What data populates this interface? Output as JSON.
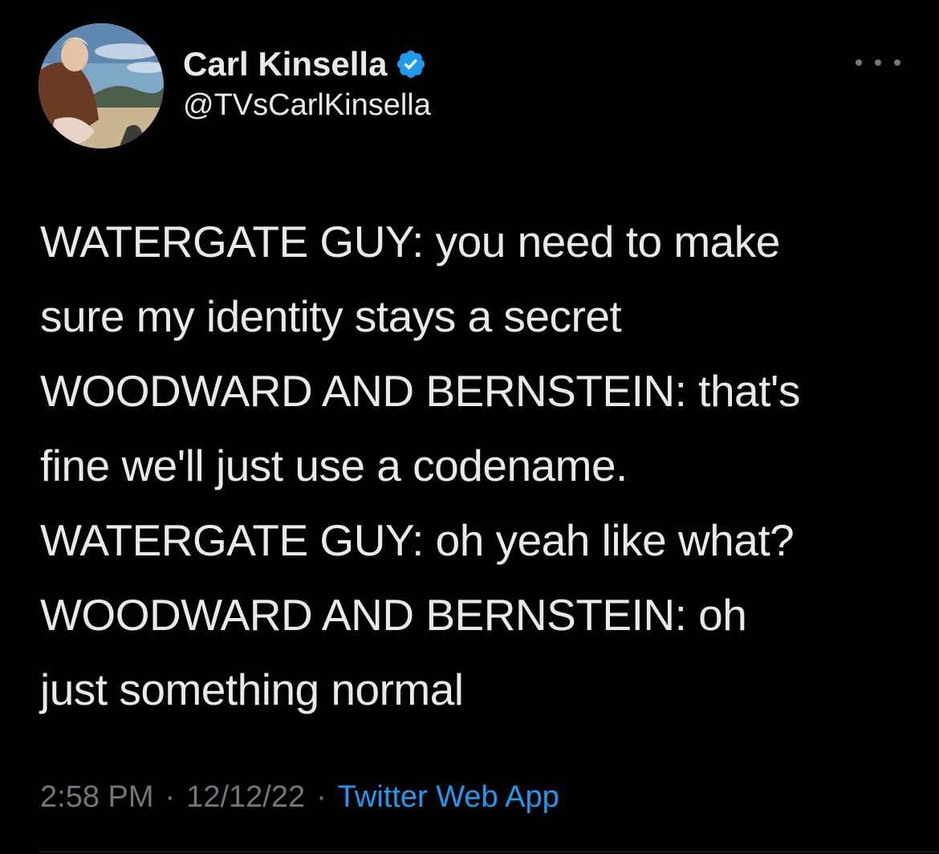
{
  "author": {
    "display_name": "Carl Kinsella",
    "handle": "@TVsCarlKinsella",
    "verified": true,
    "verified_icon": "verified-badge-icon",
    "verified_color": "#1d9bf0"
  },
  "tweet": {
    "text": "WATERGATE GUY: you need to make\nsure my identity stays a secret\nWOODWARD AND BERNSTEIN: that's\nfine we'll just use a codename.\nWATERGATE GUY: oh yeah like what?\nWOODWARD AND BERNSTEIN: oh\njust something normal",
    "time": "2:58 PM",
    "date": "12/12/22",
    "separator": "·",
    "source": "Twitter Web App"
  },
  "more_icon": "more-horizontal-icon",
  "colors": {
    "background": "#000000",
    "text": "#e7e9ea",
    "muted": "#71767b",
    "link": "#1d9bf0",
    "divider": "#2f3336"
  }
}
